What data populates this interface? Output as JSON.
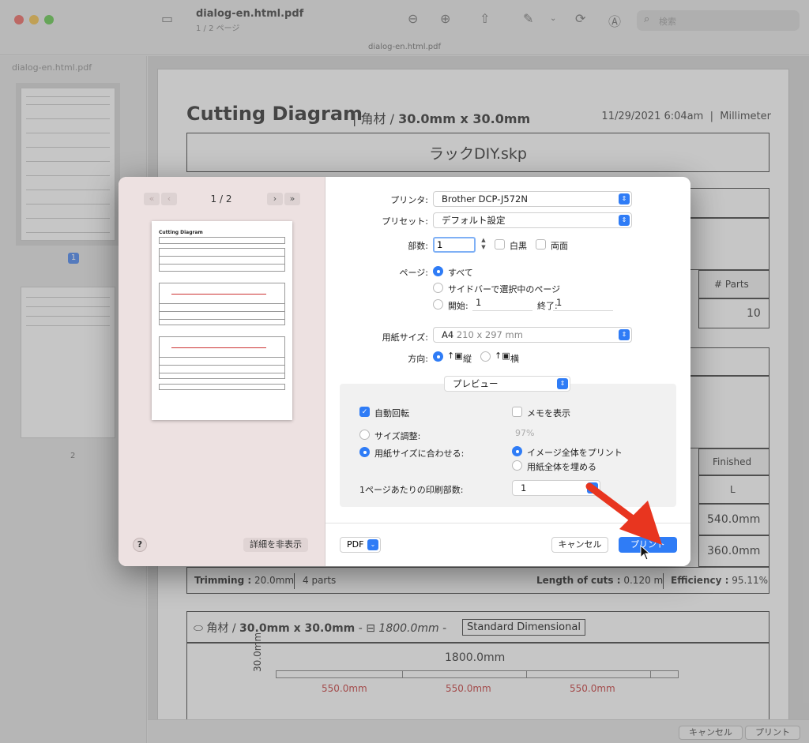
{
  "window": {
    "doc_title": "dialog-en.html.pdf",
    "doc_sub": "1 / 2 ページ",
    "tab_label": "dialog-en.html.pdf",
    "search_placeholder": "検索"
  },
  "sidebar": {
    "title": "dialog-en.html.pdf",
    "page1": "1",
    "page2": "2"
  },
  "document": {
    "title": "Cutting Diagram",
    "material_prefix": "| 角材 /",
    "material_size": "30.0mm x 30.0mm",
    "date": "11/29/2021 6:04am",
    "unit": "Millimeter",
    "model_name": "ラックDIY.skp",
    "col_parts": "# Parts",
    "parts_count": "10",
    "col_finished": "Finished",
    "finished_l": "L",
    "len_a": "540.0mm",
    "len_b": "360.0mm",
    "trimming_label": "Trimming :",
    "trimming_val": "20.0mm",
    "parts_info": "4 parts",
    "length_cuts_label": "Length of cuts :",
    "length_cuts_val": "0.120 m",
    "efficiency_label": "Efficiency :",
    "efficiency_val": "95.11%",
    "section2_material": "角材 /",
    "section2_size": "30.0mm x 30.0mm",
    "section2_length": "1800.0mm",
    "standard_label": "Standard Dimensional",
    "bar_length": "1800.0mm",
    "bar_height": "30.0mm",
    "cut_labels": [
      "550.0mm",
      "550.0mm",
      "550.0mm"
    ]
  },
  "bottom_bar": {
    "cancel": "キャンセル",
    "print": "プリント"
  },
  "dialog": {
    "page_indicator": "1 / 2",
    "preview_title": "Cutting Diagram",
    "help": "?",
    "hide_details": "詳細を非表示",
    "printer_label": "プリンタ:",
    "printer_value": "Brother DCP-J572N",
    "preset_label": "プリセット:",
    "preset_value": "デフォルト設定",
    "copies_label": "部数:",
    "copies_value": "1",
    "bw_label": "白黒",
    "duplex_label": "両面",
    "pages_label": "ページ:",
    "pages_all": "すべて",
    "pages_selected": "サイドバーで選択中のページ",
    "pages_from_label": "開始:",
    "pages_from": "1",
    "pages_to_label": "終了:",
    "pages_to": "1",
    "paper_label": "用紙サイズ:",
    "paper_value": "A4",
    "paper_dims": "210 x 297 mm",
    "orientation_label": "方向:",
    "portrait": "縦",
    "landscape": "横",
    "section_value": "プレビュー",
    "auto_rotate": "自動回転",
    "show_notes": "メモを表示",
    "scale_label": "サイズ調整:",
    "scale_value": "97%",
    "fit_label": "用紙サイズに合わせる:",
    "fit_entire": "イメージ全体をプリント",
    "fill_paper": "用紙全体を埋める",
    "per_sheet_label": "1ページあたりの印刷部数:",
    "per_sheet_value": "1",
    "pdf": "PDF",
    "cancel": "キャンセル",
    "print": "プリント"
  }
}
